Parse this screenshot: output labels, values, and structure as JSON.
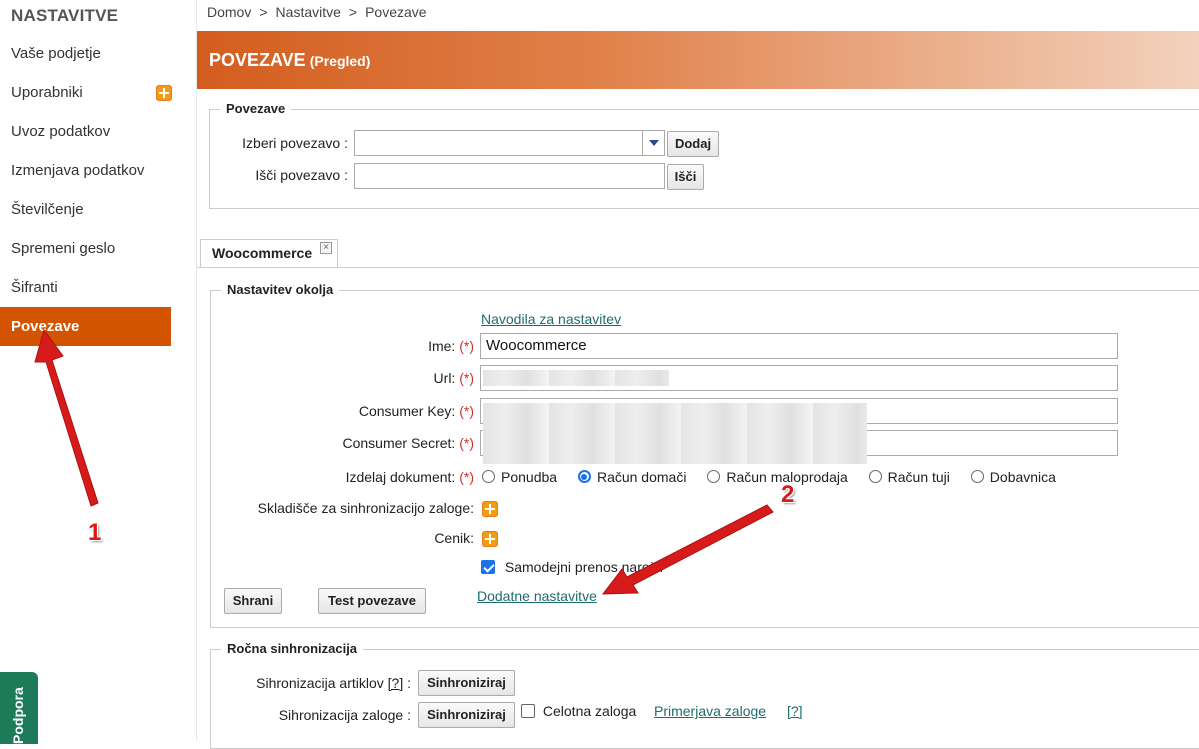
{
  "sidebar": {
    "title": "NASTAVITVE",
    "items": [
      {
        "label": "Vaše podjetje"
      },
      {
        "label": "Uporabniki"
      },
      {
        "label": "Uvoz podatkov"
      },
      {
        "label": "Izmenjava podatkov"
      },
      {
        "label": "Številčenje"
      },
      {
        "label": "Spremeni geslo"
      },
      {
        "label": "Šifranti"
      },
      {
        "label": "Povezave"
      }
    ],
    "active": "Povezave",
    "support_label": "Podpora"
  },
  "breadcrumb": [
    "Domov",
    "Nastavitve",
    "Povezave"
  ],
  "breadcrumb_sep": ">",
  "header": {
    "title": "POVEZAVE",
    "subtitle": "(Pregled)"
  },
  "povezave": {
    "legend": "Povezave",
    "select_label": "Izberi povezavo :",
    "select_value": "",
    "add_button": "Dodaj",
    "search_label": "Išči povezavo :",
    "search_value": "",
    "search_button": "Išči"
  },
  "tab": {
    "label": "Woocommerce",
    "close": "×"
  },
  "settings": {
    "legend": "Nastavitev okolja",
    "instructions_link": "Navodila za nastavitev",
    "required_mark": "(*)",
    "name_label": "Ime:",
    "name_value": "Woocommerce",
    "url_label": "Url:",
    "consumer_key_label": "Consumer Key:",
    "consumer_secret_label": "Consumer Secret:",
    "document_label": "Izdelaj dokument:",
    "document_options": [
      "Ponudba",
      "Račun domači",
      "Račun maloprodaja",
      "Račun tuji",
      "Dobavnica"
    ],
    "document_selected": "Račun domači",
    "warehouse_label": "Skladišče za sinhronizacijo zaloge:",
    "pricelist_label": "Cenik:",
    "auto_transfer_label": "Samodejni prenos naročil",
    "auto_transfer_checked": true,
    "save_button": "Shrani",
    "test_button": "Test povezave",
    "extra_settings_link": "Dodatne nastavitve"
  },
  "manual_sync": {
    "legend": "Ročna sinhronizacija",
    "articles_label_pre": "Sihronizacija artiklov",
    "help": "[?]",
    "articles_label_post": ":",
    "sync_button": "Sinhroniziraj",
    "stock_label": "Sihronizacija zaloge :",
    "full_stock_label": "Celotna zaloga",
    "full_stock_checked": false,
    "compare_link": "Primerjava zaloge"
  },
  "annotations": {
    "arrow1": "1",
    "arrow2": "2",
    "color": "#d71a1a"
  },
  "colors": {
    "accent": "#d35400",
    "link": "#1f6d6b"
  }
}
